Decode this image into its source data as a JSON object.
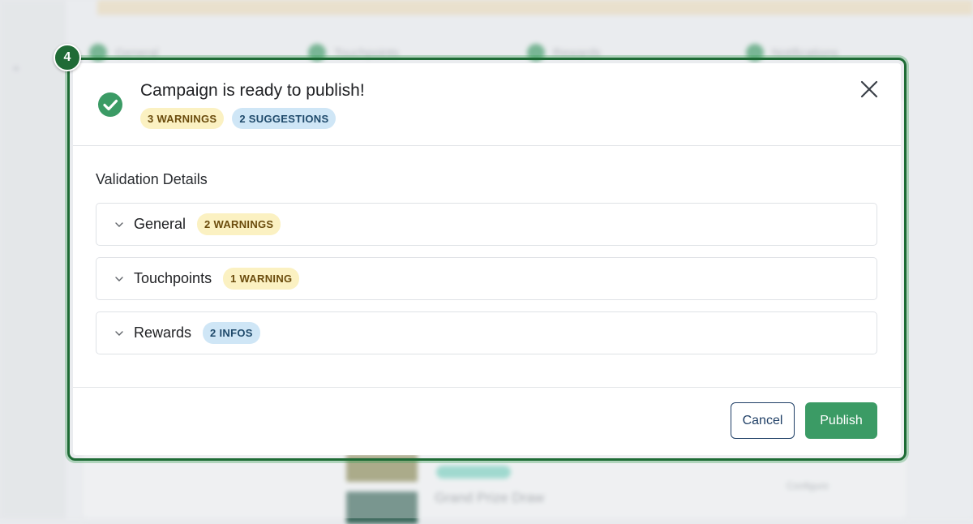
{
  "background": {
    "banner_text": "",
    "steps": [
      {
        "label": "General"
      },
      {
        "label": "Touchpoints"
      },
      {
        "label": "Rewards"
      },
      {
        "label": "Notifications"
      }
    ],
    "row_title": "Grand Prize Draw",
    "configure_label": "Configure"
  },
  "step_badge": "4",
  "modal": {
    "title": "Campaign is ready to publish!",
    "header_badges": {
      "warnings": "3 WARNINGS",
      "suggestions": "2 SUGGESTIONS"
    },
    "section_title": "Validation Details",
    "accordions": [
      {
        "label": "General",
        "badge": "2 WARNINGS",
        "badge_type": "warning"
      },
      {
        "label": "Touchpoints",
        "badge": "1 WARNING",
        "badge_type": "warning"
      },
      {
        "label": "Rewards",
        "badge": "2 INFOS",
        "badge_type": "info"
      }
    ],
    "footer": {
      "cancel_label": "Cancel",
      "publish_label": "Publish"
    }
  },
  "colors": {
    "success": "#3b9b65",
    "frame": "#1e6b35",
    "warning_bg": "#fbf1c2",
    "info_bg": "#cfe6f6"
  },
  "icons": {
    "status": "check-circle-icon",
    "close": "close-icon",
    "expand": "chevron-down-icon"
  }
}
